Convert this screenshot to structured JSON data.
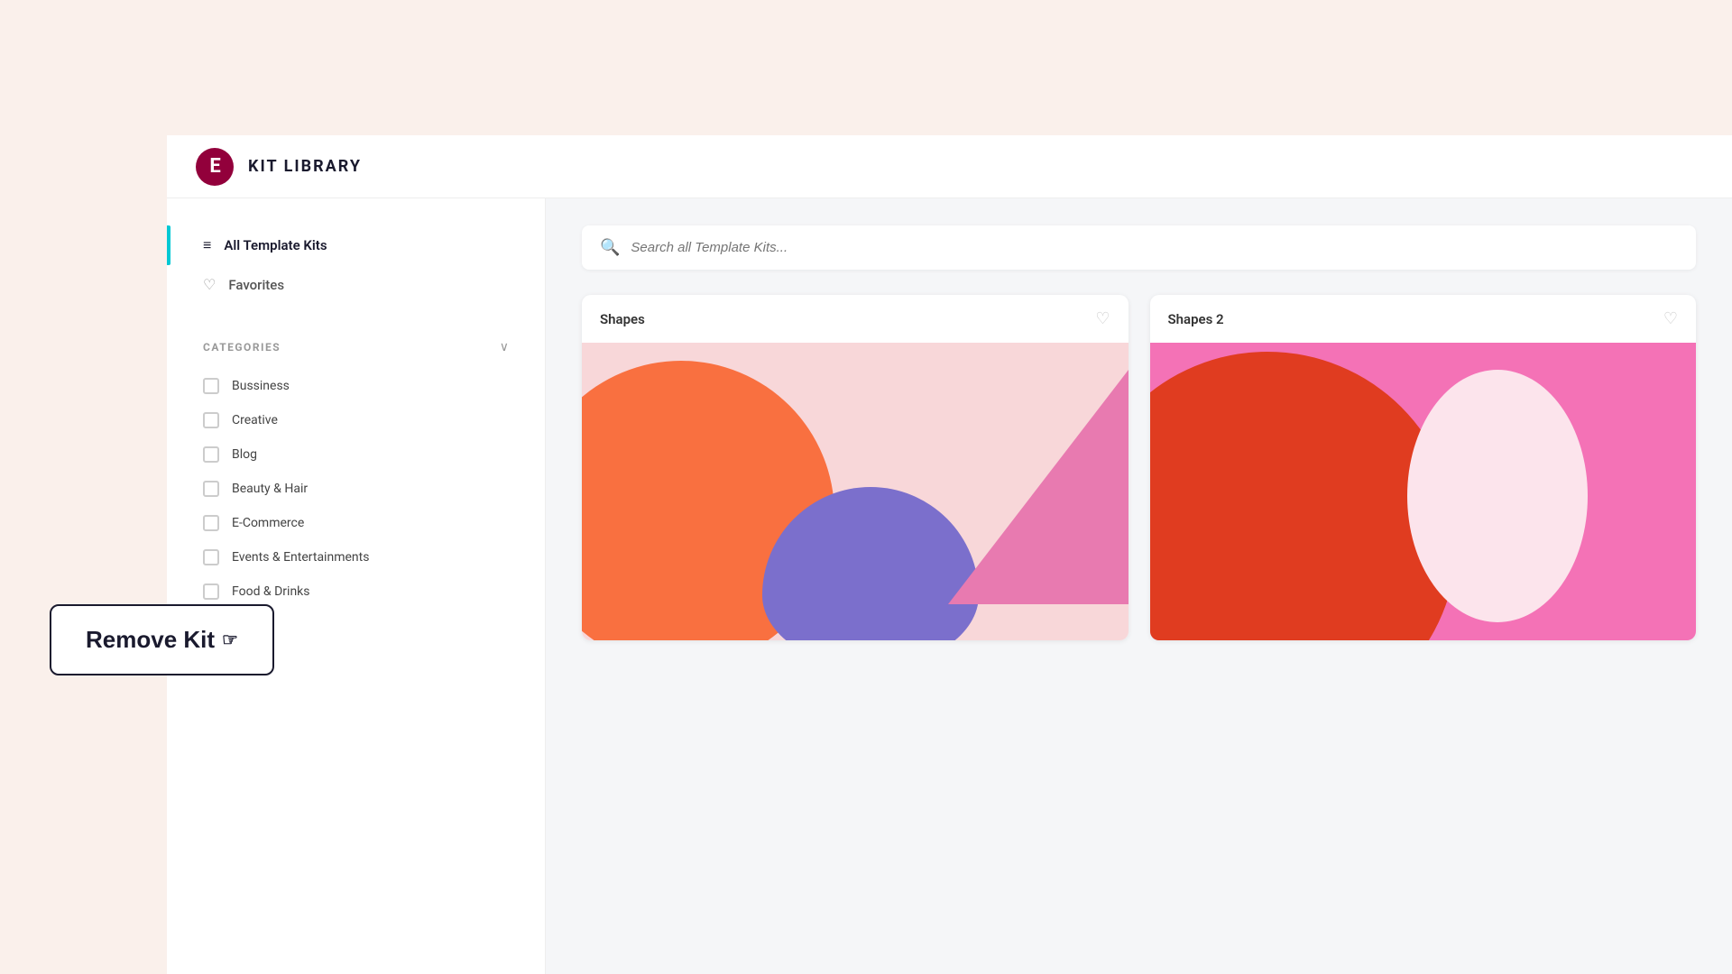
{
  "header": {
    "logo_letter": "E",
    "title": "KIT LIBRARY"
  },
  "sidebar": {
    "nav_items": [
      {
        "id": "all-template-kits",
        "label": "All Template Kits",
        "icon": "≡",
        "active": true
      },
      {
        "id": "favorites",
        "label": "Favorites",
        "icon": "♡",
        "active": false
      }
    ],
    "categories_label": "CATEGORIES",
    "categories": [
      {
        "id": "business",
        "label": "Bussiness",
        "checked": false
      },
      {
        "id": "creative",
        "label": "Creative",
        "checked": false
      },
      {
        "id": "blog",
        "label": "Blog",
        "checked": false
      },
      {
        "id": "beauty-hair",
        "label": "Beauty & Hair",
        "checked": false
      },
      {
        "id": "ecommerce",
        "label": "E-Commerce",
        "checked": false
      },
      {
        "id": "events",
        "label": "Events & Entertainments",
        "checked": false
      },
      {
        "id": "food-drinks",
        "label": "Food & Drinks",
        "checked": false
      }
    ]
  },
  "search": {
    "placeholder": "Search all Template Kits..."
  },
  "kits": [
    {
      "id": "shapes-1",
      "title": "Shapes",
      "favorited": false
    },
    {
      "id": "shapes-2",
      "title": "Shapes 2",
      "favorited": false
    }
  ],
  "remove_kit_button": {
    "label": "Remove Kit"
  },
  "colors": {
    "accent": "#00c8d4",
    "logo_bg": "#92003b",
    "header_border": "#eee"
  }
}
